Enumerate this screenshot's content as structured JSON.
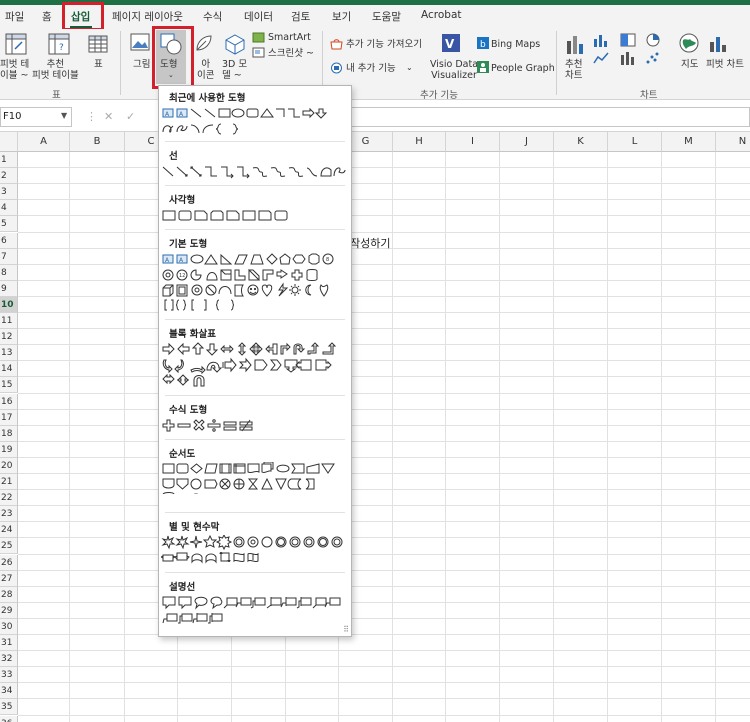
{
  "tabs": [
    "파일",
    "홈",
    "삽입",
    "페이지 레이아웃",
    "수식",
    "데이터",
    "검토",
    "보기",
    "도움말",
    "Acrobat"
  ],
  "ribbon": {
    "pivot_table_label": "피벗 테\n이블 ~",
    "recommended_pivot_label": "추천\n피벗 테이블",
    "table_label": "표",
    "group_table": "표",
    "picture_label": "그림",
    "shapes_label": "도형",
    "icons_label": "아\n이콘",
    "model3d_label": "3D 모\n델 ~",
    "smartart_label": "SmartArt",
    "screenshot_label": "스크린샷 ~",
    "get_addins_label": "추가 기능 가져오기",
    "my_addins_label": "내 추가 기능",
    "visio_label": "Visio Data\nVisualizer",
    "bing_maps_label": "Bing Maps",
    "people_graph_label": "People Graph",
    "group_addins": "추가 기능",
    "recommended_charts_label": "추천\n차트",
    "maps_label": "지도",
    "pivot_chart_label": "피벗 차트",
    "group_charts": "차트"
  },
  "formula_bar": {
    "name_box": "F10"
  },
  "sheet": {
    "columns": [
      "A",
      "B",
      "C",
      "D",
      "E",
      "F",
      "G",
      "H",
      "I",
      "J",
      "K",
      "L",
      "M",
      "N"
    ],
    "rows": [
      "1",
      "2",
      "3",
      "4",
      "5",
      "6",
      "7",
      "8",
      "9",
      "10",
      "11",
      "12",
      "13",
      "14",
      "15",
      "16",
      "17",
      "18",
      "19",
      "20",
      "21",
      "22",
      "23",
      "24",
      "25",
      "26",
      "27",
      "28",
      "29",
      "30",
      "31",
      "32",
      "33",
      "34",
      "35",
      "36"
    ],
    "selected_row": "10",
    "cell_text": "작성하기"
  },
  "shapes_menu": {
    "sections": [
      "최근에 사용한 도형",
      "선",
      "사각형",
      "기본 도형",
      "블록 화살표",
      "수식 도형",
      "순서도",
      "별 및 현수막",
      "설명선"
    ]
  },
  "colors": {
    "excel_green": "#1e7145",
    "highlight_red": "#d2202d",
    "ribbon_bg": "#f3f3f3"
  }
}
